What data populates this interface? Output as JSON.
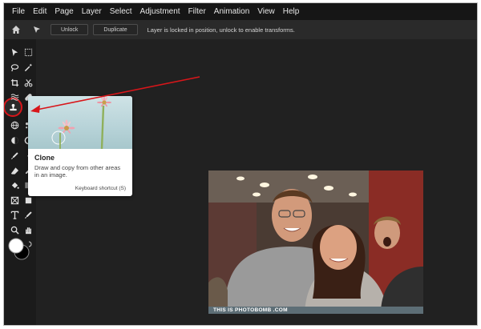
{
  "menu": [
    "File",
    "Edit",
    "Page",
    "Layer",
    "Select",
    "Adjustment",
    "Filter",
    "Animation",
    "View",
    "Help"
  ],
  "toolbar": {
    "unlock_label": "Unlock",
    "duplicate_label": "Duplicate",
    "message": "Layer is locked in position, unlock to enable transforms."
  },
  "tooltip": {
    "title": "Clone",
    "description": "Draw and copy from other areas in an image.",
    "shortcut": "Keyboard shortcut (S)"
  },
  "photo": {
    "caption": "THIS IS PHOTOBOMB .COM"
  },
  "colors": {
    "highlight": "#d8161a",
    "arrow": "#d8161a",
    "primary": "#ffffff",
    "secondary": "#000000"
  }
}
